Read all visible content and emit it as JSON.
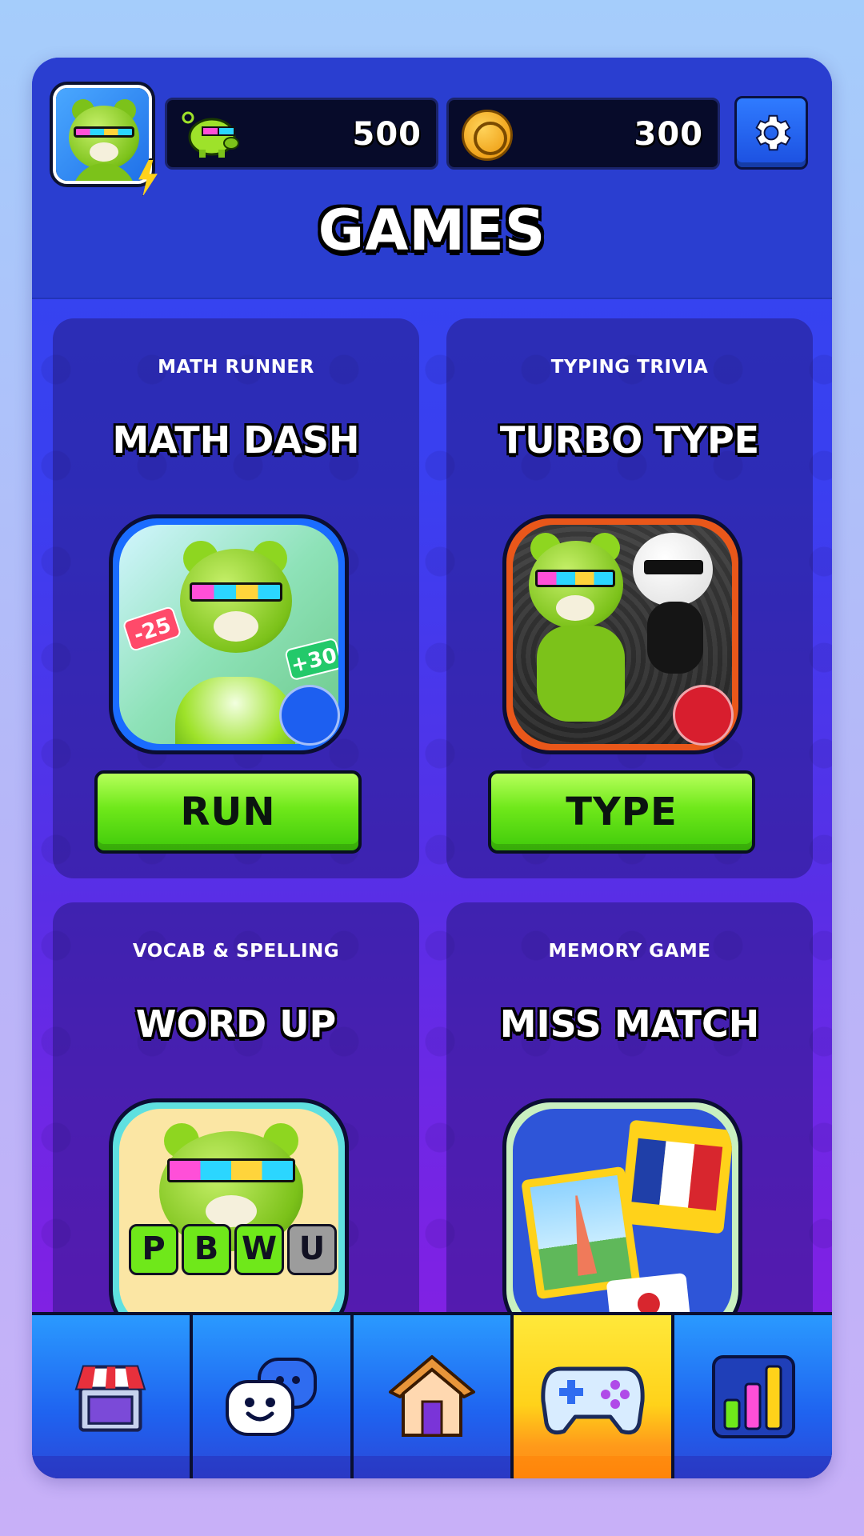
{
  "header": {
    "page_title": "GAMES",
    "currencies": [
      {
        "icon": "pig-bank-icon",
        "value": "500"
      },
      {
        "icon": "coin-icon",
        "value": "300"
      }
    ],
    "settings_icon": "gear-icon"
  },
  "games": [
    {
      "subtitle": "MATH RUNNER",
      "title": "MATH DASH",
      "button": "RUN",
      "thumb_labels": [
        "-25",
        "+30"
      ]
    },
    {
      "subtitle": "TYPING TRIVIA",
      "title": "TURBO TYPE",
      "button": "TYPE"
    },
    {
      "subtitle": "VOCAB & SPELLING",
      "title": "WORD UP",
      "letters": [
        "P",
        "B",
        "W",
        "U"
      ]
    },
    {
      "subtitle": "MEMORY GAME",
      "title": "MISS MATCH"
    }
  ],
  "nav": {
    "items": [
      {
        "icon": "shop-icon",
        "active": false
      },
      {
        "icon": "chat-icon",
        "active": false
      },
      {
        "icon": "home-icon",
        "active": false
      },
      {
        "icon": "gamepad-icon",
        "active": true
      },
      {
        "icon": "leaderboard-icon",
        "active": false
      }
    ]
  },
  "colors": {
    "accent_green": "#6fe81a",
    "nav_active": "#ffd21a",
    "header_blue": "#2a3ed0"
  }
}
